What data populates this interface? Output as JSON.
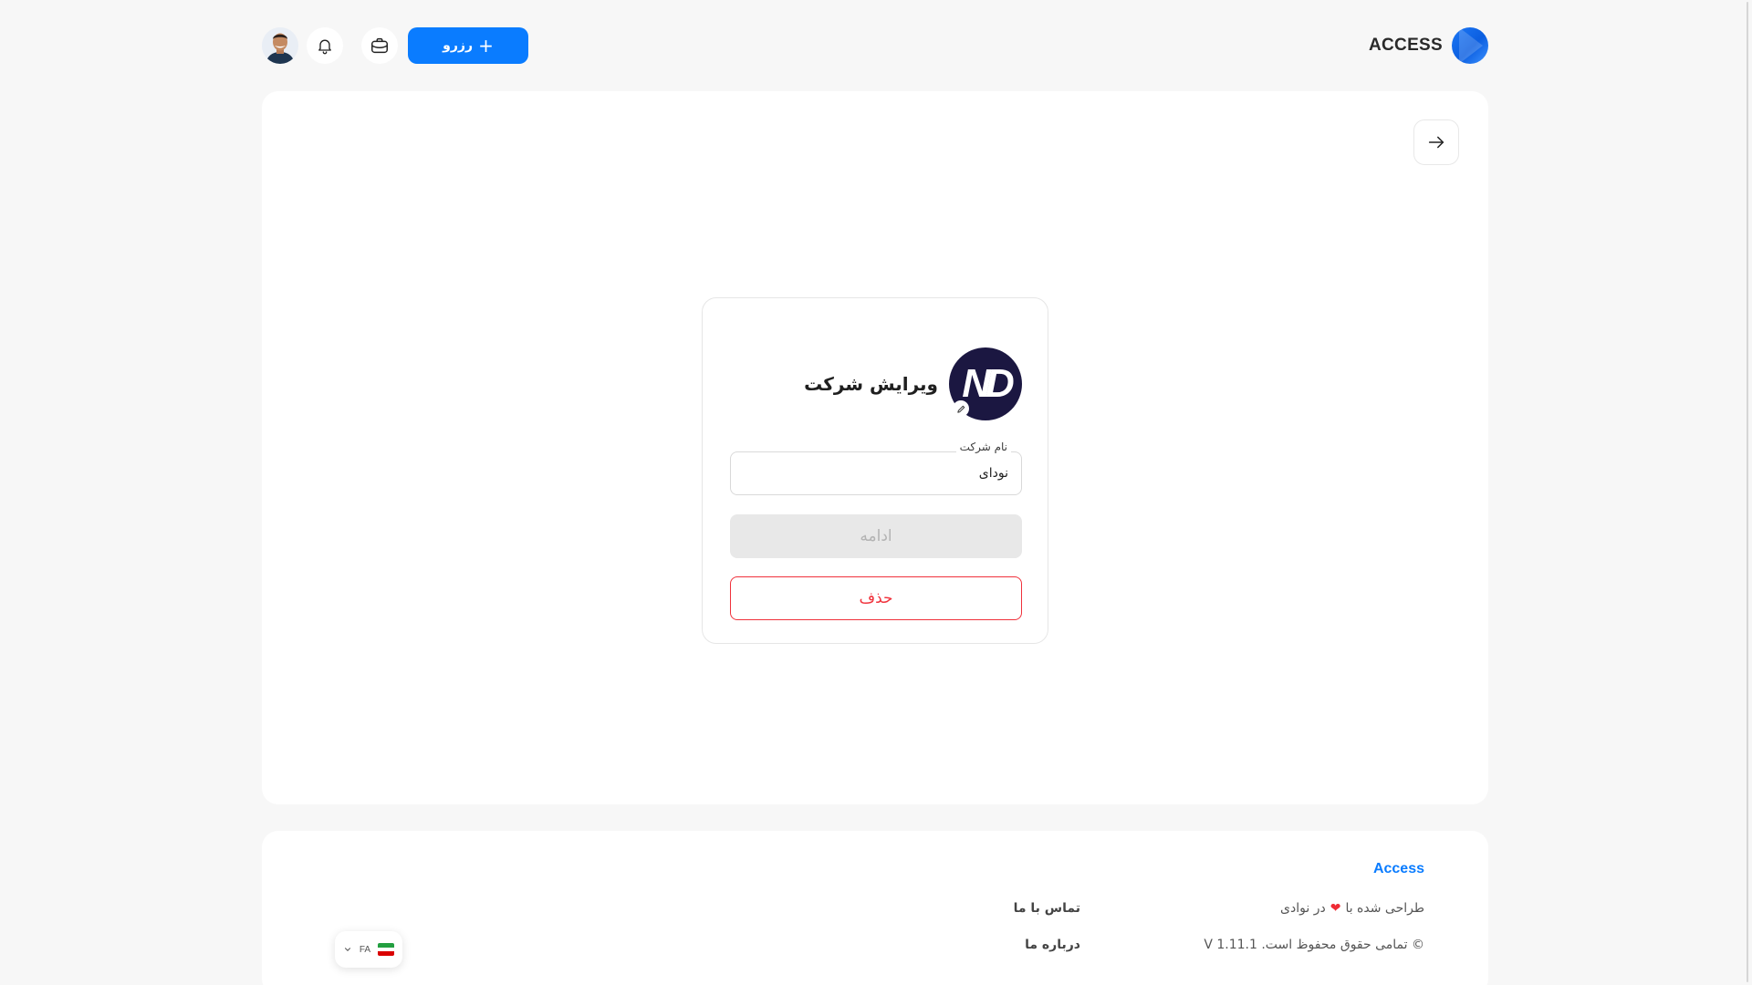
{
  "header": {
    "logo_text": "ACCESS",
    "reserve_label": "رزرو",
    "icons": [
      "avatar",
      "bell-icon",
      "briefcase-icon",
      "plus-icon"
    ]
  },
  "main": {
    "back_icon": "arrow-right-icon",
    "edit_form": {
      "title": "ویرایش شرکت",
      "logo_text": "ND",
      "company_name_label": "نام شرکت",
      "company_name_value": "نودای",
      "continue_label": "ادامه",
      "delete_label": "حذف"
    }
  },
  "footer": {
    "brand": "Access",
    "designed_prefix": "طراحی شده با",
    "designed_suffix": "در نوادی",
    "copyright": "© تمامی حقوق محفوظ است. V 1.11.1",
    "contact_label": "تماس با ما",
    "about_label": "درباره ما",
    "language_code": "FA"
  },
  "colors": {
    "accent": "#0a7cff",
    "danger": "#f0323c",
    "company_logo_bg": "#1b1741"
  }
}
